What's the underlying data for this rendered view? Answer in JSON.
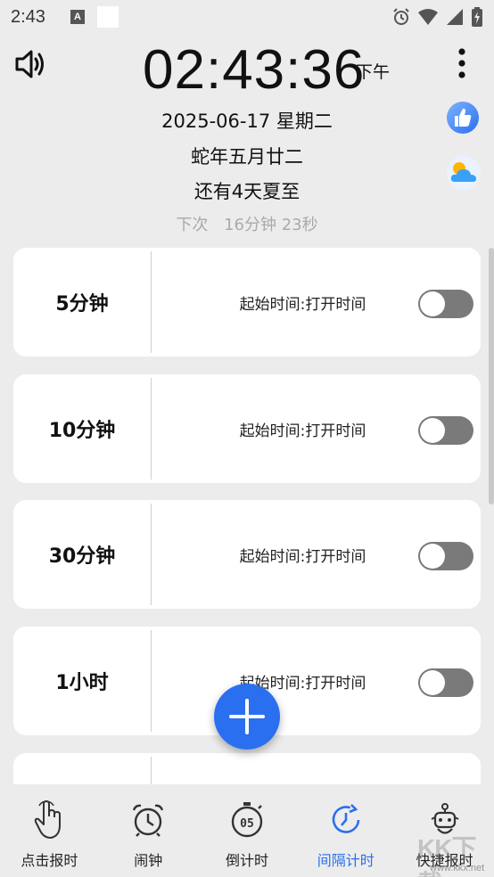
{
  "status_bar": {
    "time": "2:43",
    "a_icon": "A"
  },
  "header": {
    "clock": "02:43:36",
    "ampm": "下午",
    "date": "2025-06-17 星期二",
    "lunar": "蛇年五月廿二",
    "solar_term": "还有4天夏至",
    "next_label": "下次",
    "next_value": "16分钟 23秒"
  },
  "timers": [
    {
      "label": "5分钟",
      "start": "起始时间:打开时间",
      "enabled": false
    },
    {
      "label": "10分钟",
      "start": "起始时间:打开时间",
      "enabled": false
    },
    {
      "label": "30分钟",
      "start": "起始时间:打开时间",
      "enabled": false
    },
    {
      "label": "1小时",
      "start": "起始时间:打开时间",
      "enabled": false
    }
  ],
  "nav": [
    {
      "label": "点击报时",
      "icon": "tap-hand-icon",
      "active": false
    },
    {
      "label": "闹钟",
      "icon": "alarm-clock-icon",
      "active": false
    },
    {
      "label": "倒计时",
      "icon": "stopwatch-icon",
      "active": false
    },
    {
      "label": "间隔计时",
      "icon": "interval-clock-icon",
      "active": true
    },
    {
      "label": "快捷报时",
      "icon": "robot-icon",
      "active": false
    }
  ],
  "colors": {
    "accent": "#2a6ff0",
    "toggle_off": "#7a7a7a",
    "background": "#ececec"
  },
  "watermark": {
    "text": "KK下载",
    "url": "www.kkx.net"
  }
}
